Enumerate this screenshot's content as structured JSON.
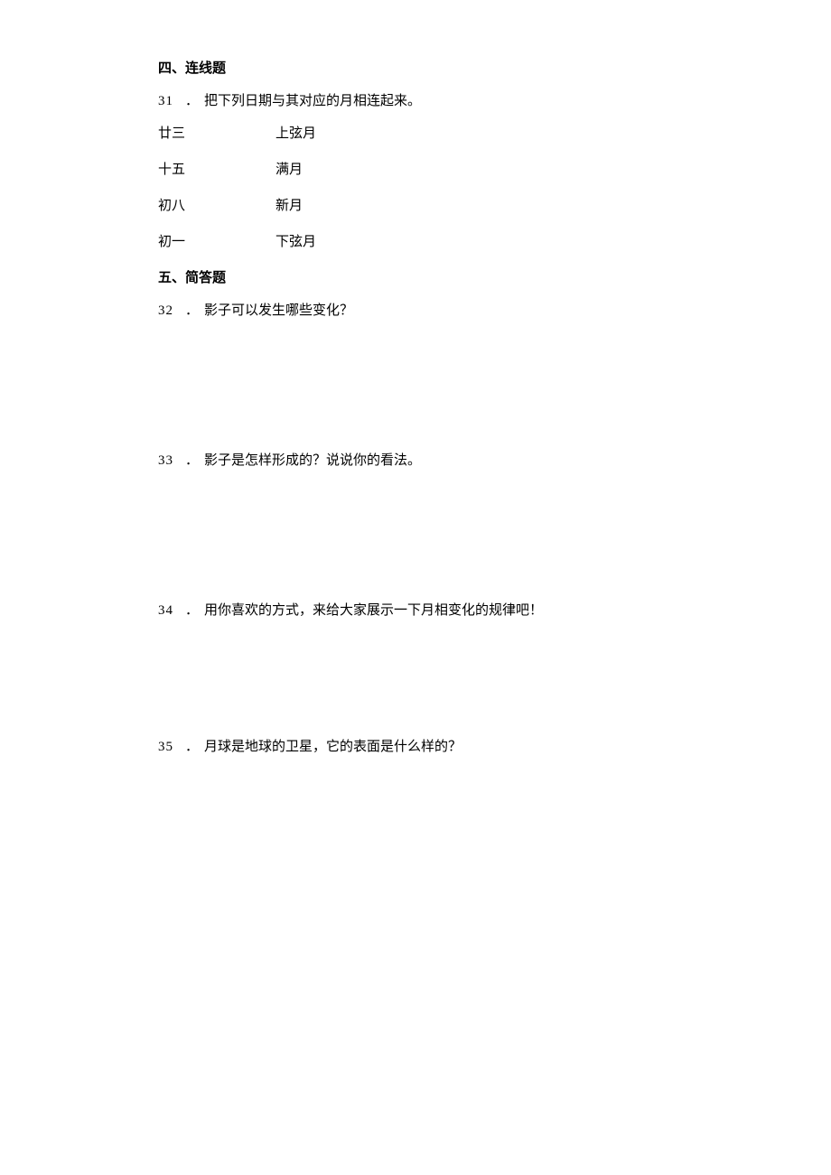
{
  "sections": {
    "section4": {
      "heading": "四、连线题",
      "q31": {
        "number": "31",
        "dot": "．",
        "text": "把下列日期与其对应的月相连起来。"
      },
      "matching": {
        "row1": {
          "left": "廿三",
          "right": "上弦月"
        },
        "row2": {
          "left": "十五",
          "right": "满月"
        },
        "row3": {
          "left": "初八",
          "right": "新月"
        },
        "row4": {
          "left": "初一",
          "right": "下弦月"
        }
      }
    },
    "section5": {
      "heading": "五、简答题",
      "q32": {
        "number": "32",
        "dot": "．",
        "text": "影子可以发生哪些变化？"
      },
      "q33": {
        "number": "33",
        "dot": "．",
        "text": "影子是怎样形成的？说说你的看法。"
      },
      "q34": {
        "number": "34",
        "dot": "．",
        "text": "用你喜欢的方式，来给大家展示一下月相变化的规律吧！"
      },
      "q35": {
        "number": "35",
        "dot": "．",
        "text": "月球是地球的卫星，它的表面是什么样的？"
      }
    }
  }
}
